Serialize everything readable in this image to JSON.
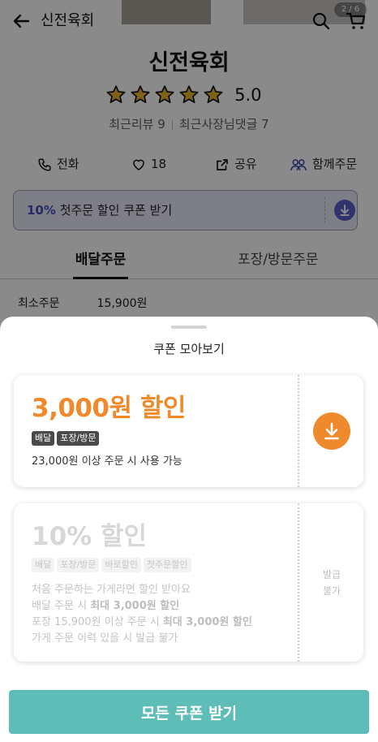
{
  "header": {
    "title": "신전육회",
    "page_counter": "2 / 6"
  },
  "store": {
    "name": "신전육회",
    "rating": 5.0,
    "rating_label": "5.0",
    "star_count": 5,
    "recent_reviews": "최근리뷰 9",
    "owner_comments": "최근사장님댓글 7"
  },
  "actions": {
    "call": "전화",
    "like_count": "18",
    "share": "공유",
    "group_order": "함께주문"
  },
  "coupon_banner": {
    "highlight": "10%",
    "text": "첫주문 할인 쿠폰 받기"
  },
  "tabs": {
    "delivery": "배달주문",
    "pickup": "포장/방문주문"
  },
  "min_order": {
    "label": "최소주문",
    "value": "15,900원"
  },
  "sheet": {
    "title": "쿠폰 모아보기",
    "coupons": [
      {
        "amount": "3,000원 할인",
        "tags": [
          "배달",
          "포장/방문"
        ],
        "condition": "23,000원 이상 주문 시 사용 가능"
      },
      {
        "amount": "10% 할인",
        "tags": [
          "배달",
          "포장/방문",
          "바로할인",
          "첫주문할인"
        ],
        "desc": {
          "line1": "처음 주문하는 가게라면 할인 받아요",
          "line2_pre": "배달 주문 시 ",
          "line2_bold": "최대 3,000원 할인",
          "line3_pre": "포장 15,900원 이상 주문 시 ",
          "line3_bold": "최대 3,000원 할인",
          "line4": "가게 주문 이력 있을 시 발급 불가"
        },
        "status_line1": "발급",
        "status_line2": "불가"
      }
    ],
    "button_label": "모든 쿠폰 받기"
  },
  "colors": {
    "accent_orange": "#ee8a2c",
    "accent_teal": "#5fbdb7",
    "accent_purple": "#4a4fbf"
  },
  "icons": [
    "back-arrow-icon",
    "search-icon",
    "cart-icon",
    "star-icon",
    "phone-icon",
    "heart-icon",
    "share-icon",
    "group-icon",
    "download-icon"
  ]
}
